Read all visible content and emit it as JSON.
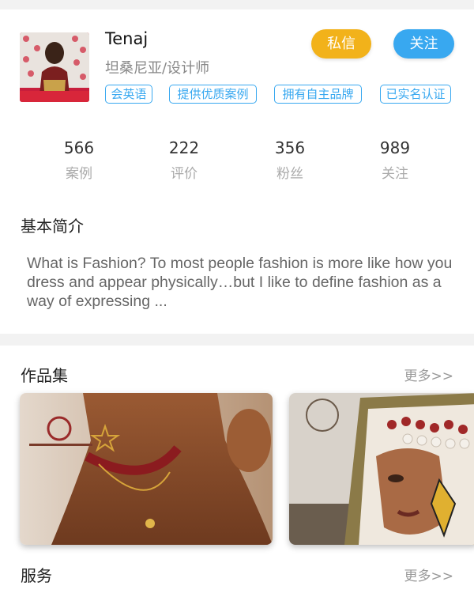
{
  "profile": {
    "name": "Tenaj",
    "location": "坦桑尼亚/设计师",
    "message_button": "私信",
    "follow_button": "关注",
    "tags": [
      "会英语",
      "提供优质案例",
      "拥有自主品牌",
      "已实名认证"
    ],
    "stats": [
      {
        "value": "566",
        "label": "案例"
      },
      {
        "value": "222",
        "label": "评价"
      },
      {
        "value": "356",
        "label": "粉丝"
      },
      {
        "value": "989",
        "label": "关注"
      }
    ]
  },
  "intro": {
    "title": "基本简介",
    "text": "What is Fashion? To most people fashion is more like how you dress and appear physically…but  I like to define fashion as a way of expressing ..."
  },
  "works": {
    "title": "作品集",
    "more": "更多>>",
    "items": [
      {
        "image": "necklace-model-photo"
      },
      {
        "image": "beaded-portrait-art-photo"
      }
    ]
  },
  "services": {
    "title": "服务",
    "more": "更多>>"
  },
  "colors": {
    "message_button": "#f2b21a",
    "follow_button": "#38a8f0",
    "tag_border": "#38a8f0"
  }
}
